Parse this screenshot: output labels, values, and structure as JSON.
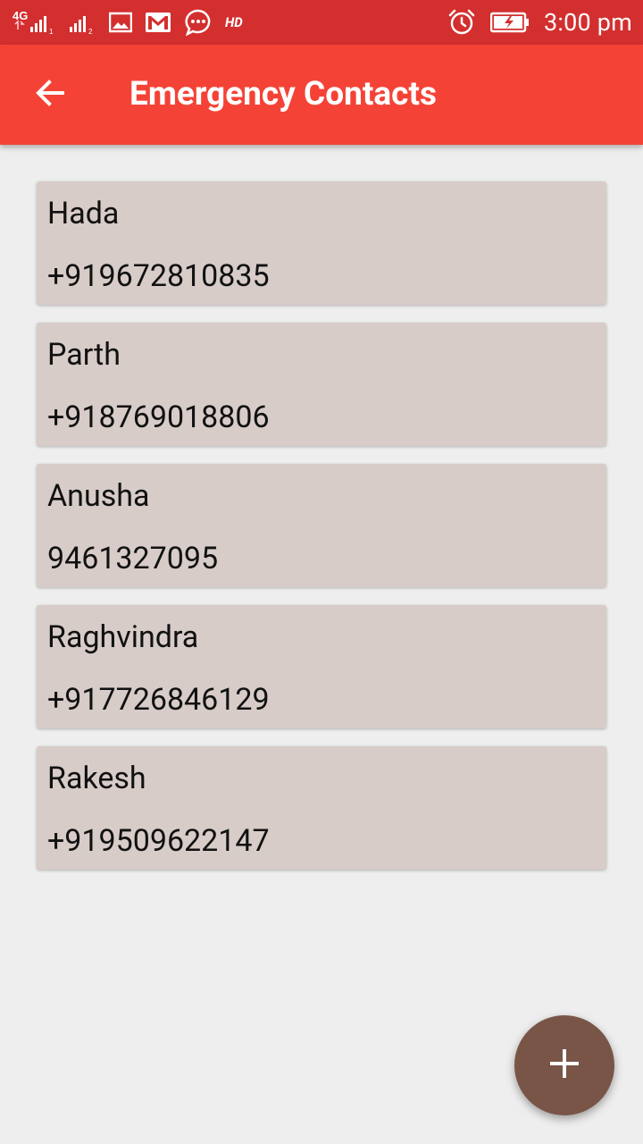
{
  "status_bar": {
    "network": "4G",
    "hd": "HD",
    "time": "3:00 pm",
    "icons": [
      "signal-sim1-icon",
      "signal-sim2-icon",
      "gallery-icon",
      "gmail-icon",
      "message-icon",
      "alarm-icon",
      "battery-charging-icon"
    ]
  },
  "app_bar": {
    "title": "Emergency Contacts",
    "back_icon": "back-arrow-icon"
  },
  "contacts": [
    {
      "name": "Hada",
      "phone": "+919672810835"
    },
    {
      "name": "Parth",
      "phone": "+918769018806"
    },
    {
      "name": "Anusha",
      "phone": "9461327095"
    },
    {
      "name": "Raghvindra",
      "phone": "+917726846129"
    },
    {
      "name": "Rakesh",
      "phone": "+919509622147"
    }
  ],
  "fab": {
    "icon": "add-icon"
  },
  "colors": {
    "status_bar": "#d32f2f",
    "app_bar": "#f44336",
    "card": "#d7ccc8",
    "fab": "#795548",
    "background": "#eeeeee"
  }
}
